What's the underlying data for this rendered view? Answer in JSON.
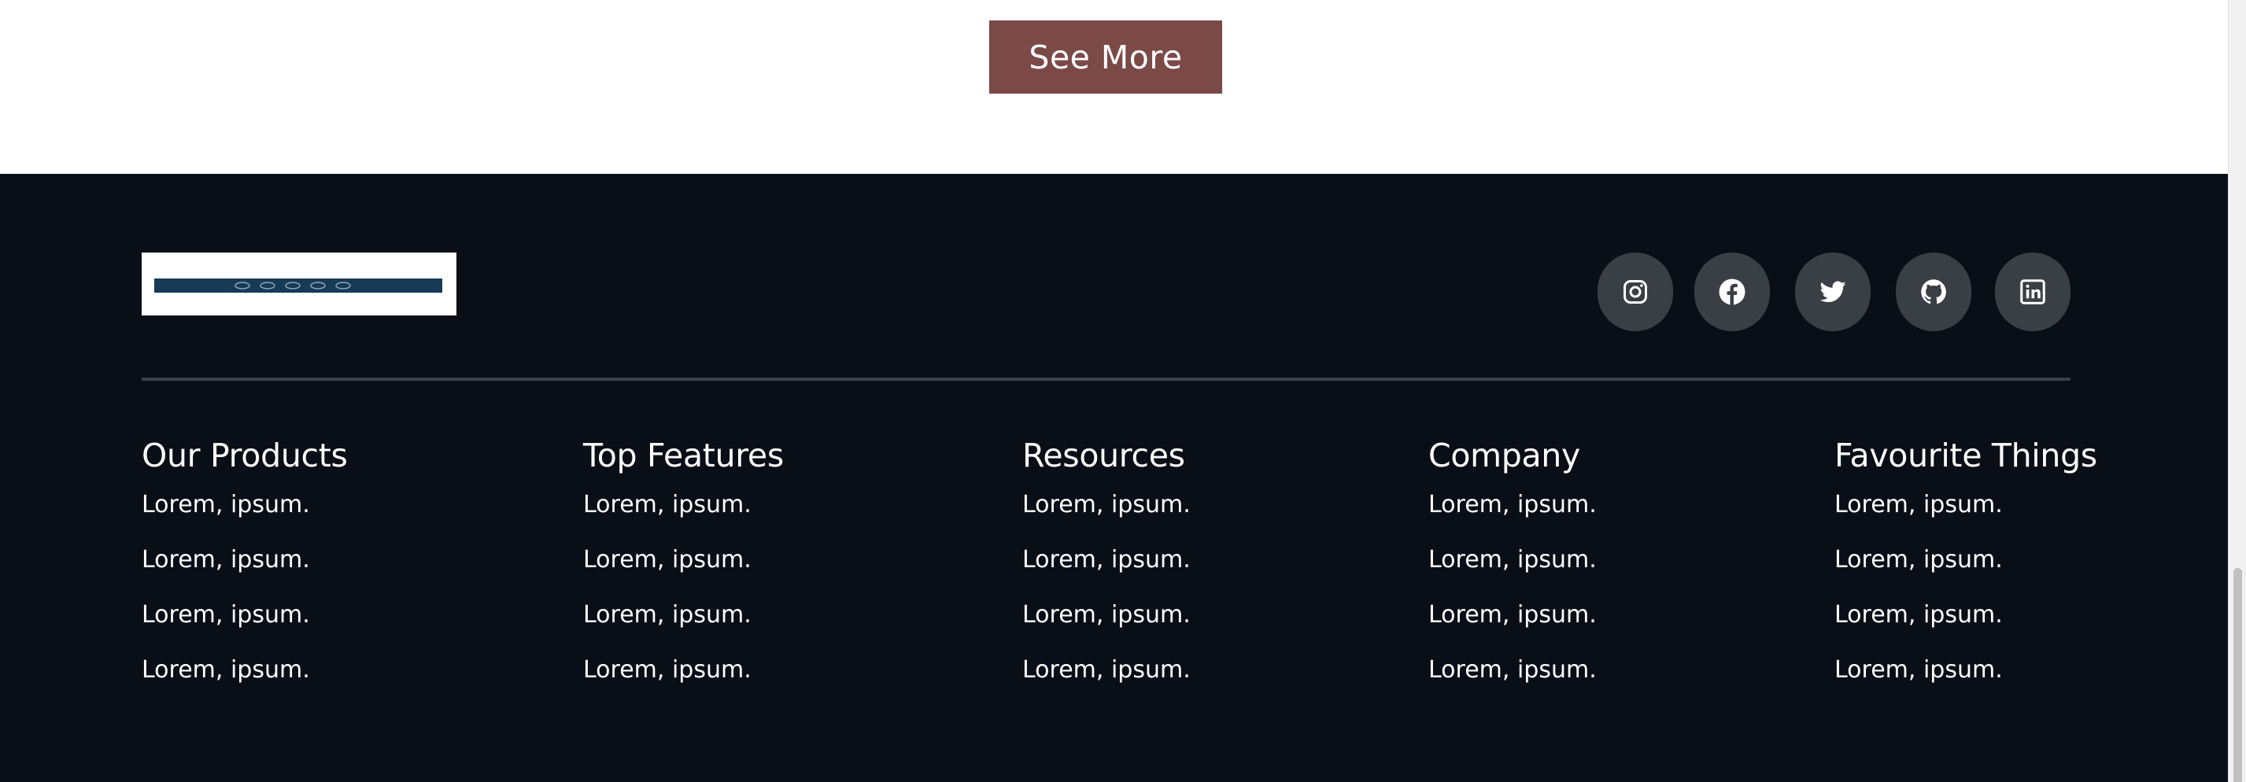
{
  "see_more": {
    "label": "See More"
  },
  "footer": {
    "logo": {
      "text": "logo"
    },
    "social": [
      {
        "icon": "instagram-icon"
      },
      {
        "icon": "facebook-icon"
      },
      {
        "icon": "twitter-icon"
      },
      {
        "icon": "github-icon"
      },
      {
        "icon": "linkedin-icon"
      }
    ],
    "columns": [
      {
        "title": "Our Products",
        "items": [
          "Lorem, ipsum.",
          "Lorem, ipsum.",
          "Lorem, ipsum.",
          "Lorem, ipsum."
        ]
      },
      {
        "title": "Top Features",
        "items": [
          "Lorem, ipsum.",
          "Lorem, ipsum.",
          "Lorem, ipsum.",
          "Lorem, ipsum."
        ]
      },
      {
        "title": "Resources",
        "items": [
          "Lorem, ipsum.",
          "Lorem, ipsum.",
          "Lorem, ipsum.",
          "Lorem, ipsum."
        ]
      },
      {
        "title": "Company",
        "items": [
          "Lorem, ipsum.",
          "Lorem, ipsum.",
          "Lorem, ipsum.",
          "Lorem, ipsum."
        ]
      },
      {
        "title": "Favourite Things",
        "items": [
          "Lorem, ipsum.",
          "Lorem, ipsum.",
          "Lorem, ipsum.",
          "Lorem, ipsum."
        ]
      }
    ]
  },
  "colors": {
    "accent": "#7b4a47",
    "footer_bg": "#0a0e16",
    "social_bg": "#3a3f46"
  }
}
